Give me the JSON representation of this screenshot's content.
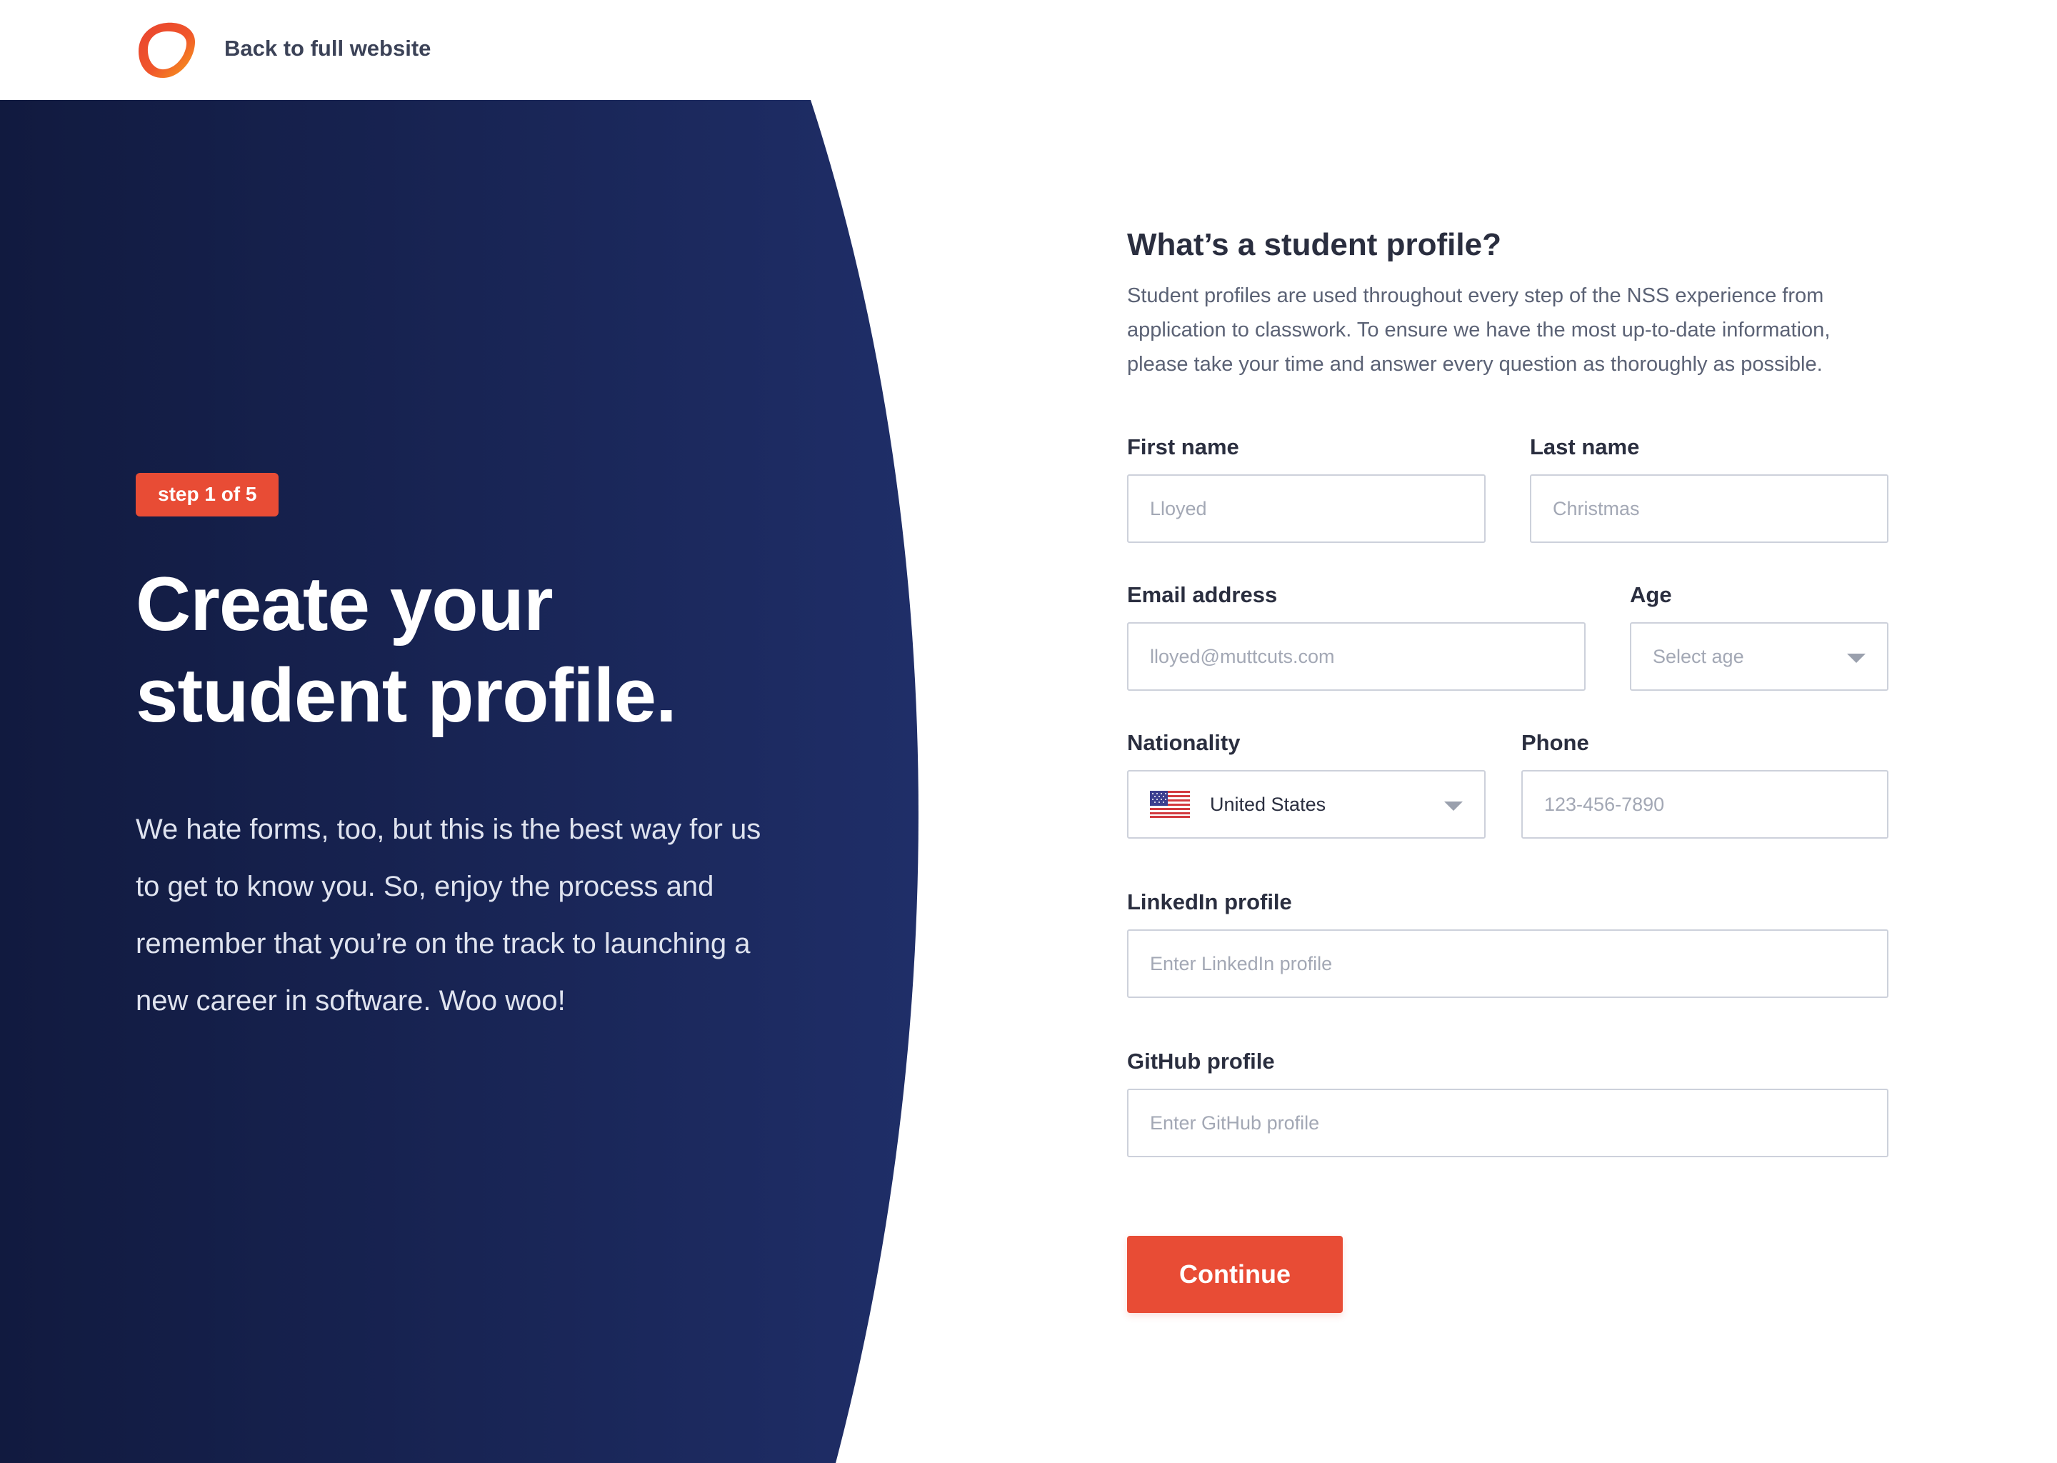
{
  "header": {
    "back_link": "Back to full website",
    "logo_icon": "ring-logo-icon"
  },
  "hero": {
    "step_badge": "step 1 of 5",
    "title_line1": "Create your",
    "title_line2": "student profile.",
    "description": "We hate forms, too, but this is the best way for us to get to know you. So, enjoy the process and remember that you’re on the track to launching a new career in software. Woo woo!"
  },
  "form": {
    "heading": "What’s a student profile?",
    "intro": "Student profiles are used throughout every step of the NSS experience from application to classwork. To ensure we have the most up-to-date information, please take your time and answer every question as thoroughly as possible.",
    "first_name": {
      "label": "First name",
      "placeholder": "Lloyed",
      "value": ""
    },
    "last_name": {
      "label": "Last name",
      "placeholder": "Christmas",
      "value": ""
    },
    "email": {
      "label": "Email address",
      "placeholder": "lloyed@muttcuts.com",
      "value": ""
    },
    "age": {
      "label": "Age",
      "selected": "Select age"
    },
    "nationality": {
      "label": "Nationality",
      "selected": "United States",
      "flag_icon": "us-flag-icon"
    },
    "phone": {
      "label": "Phone",
      "placeholder": "123-456-7890",
      "value": ""
    },
    "linkedin": {
      "label": "LinkedIn profile",
      "placeholder": "Enter LinkedIn profile",
      "value": ""
    },
    "github": {
      "label": "GitHub profile",
      "placeholder": "Enter GitHub profile",
      "value": ""
    },
    "continue_label": "Continue"
  },
  "colors": {
    "accent": "#e84c35",
    "hero_dark": "#111a3f",
    "hero_light": "#1e2e66",
    "text_dark": "#2a2e3f",
    "border": "#cdd1db"
  }
}
